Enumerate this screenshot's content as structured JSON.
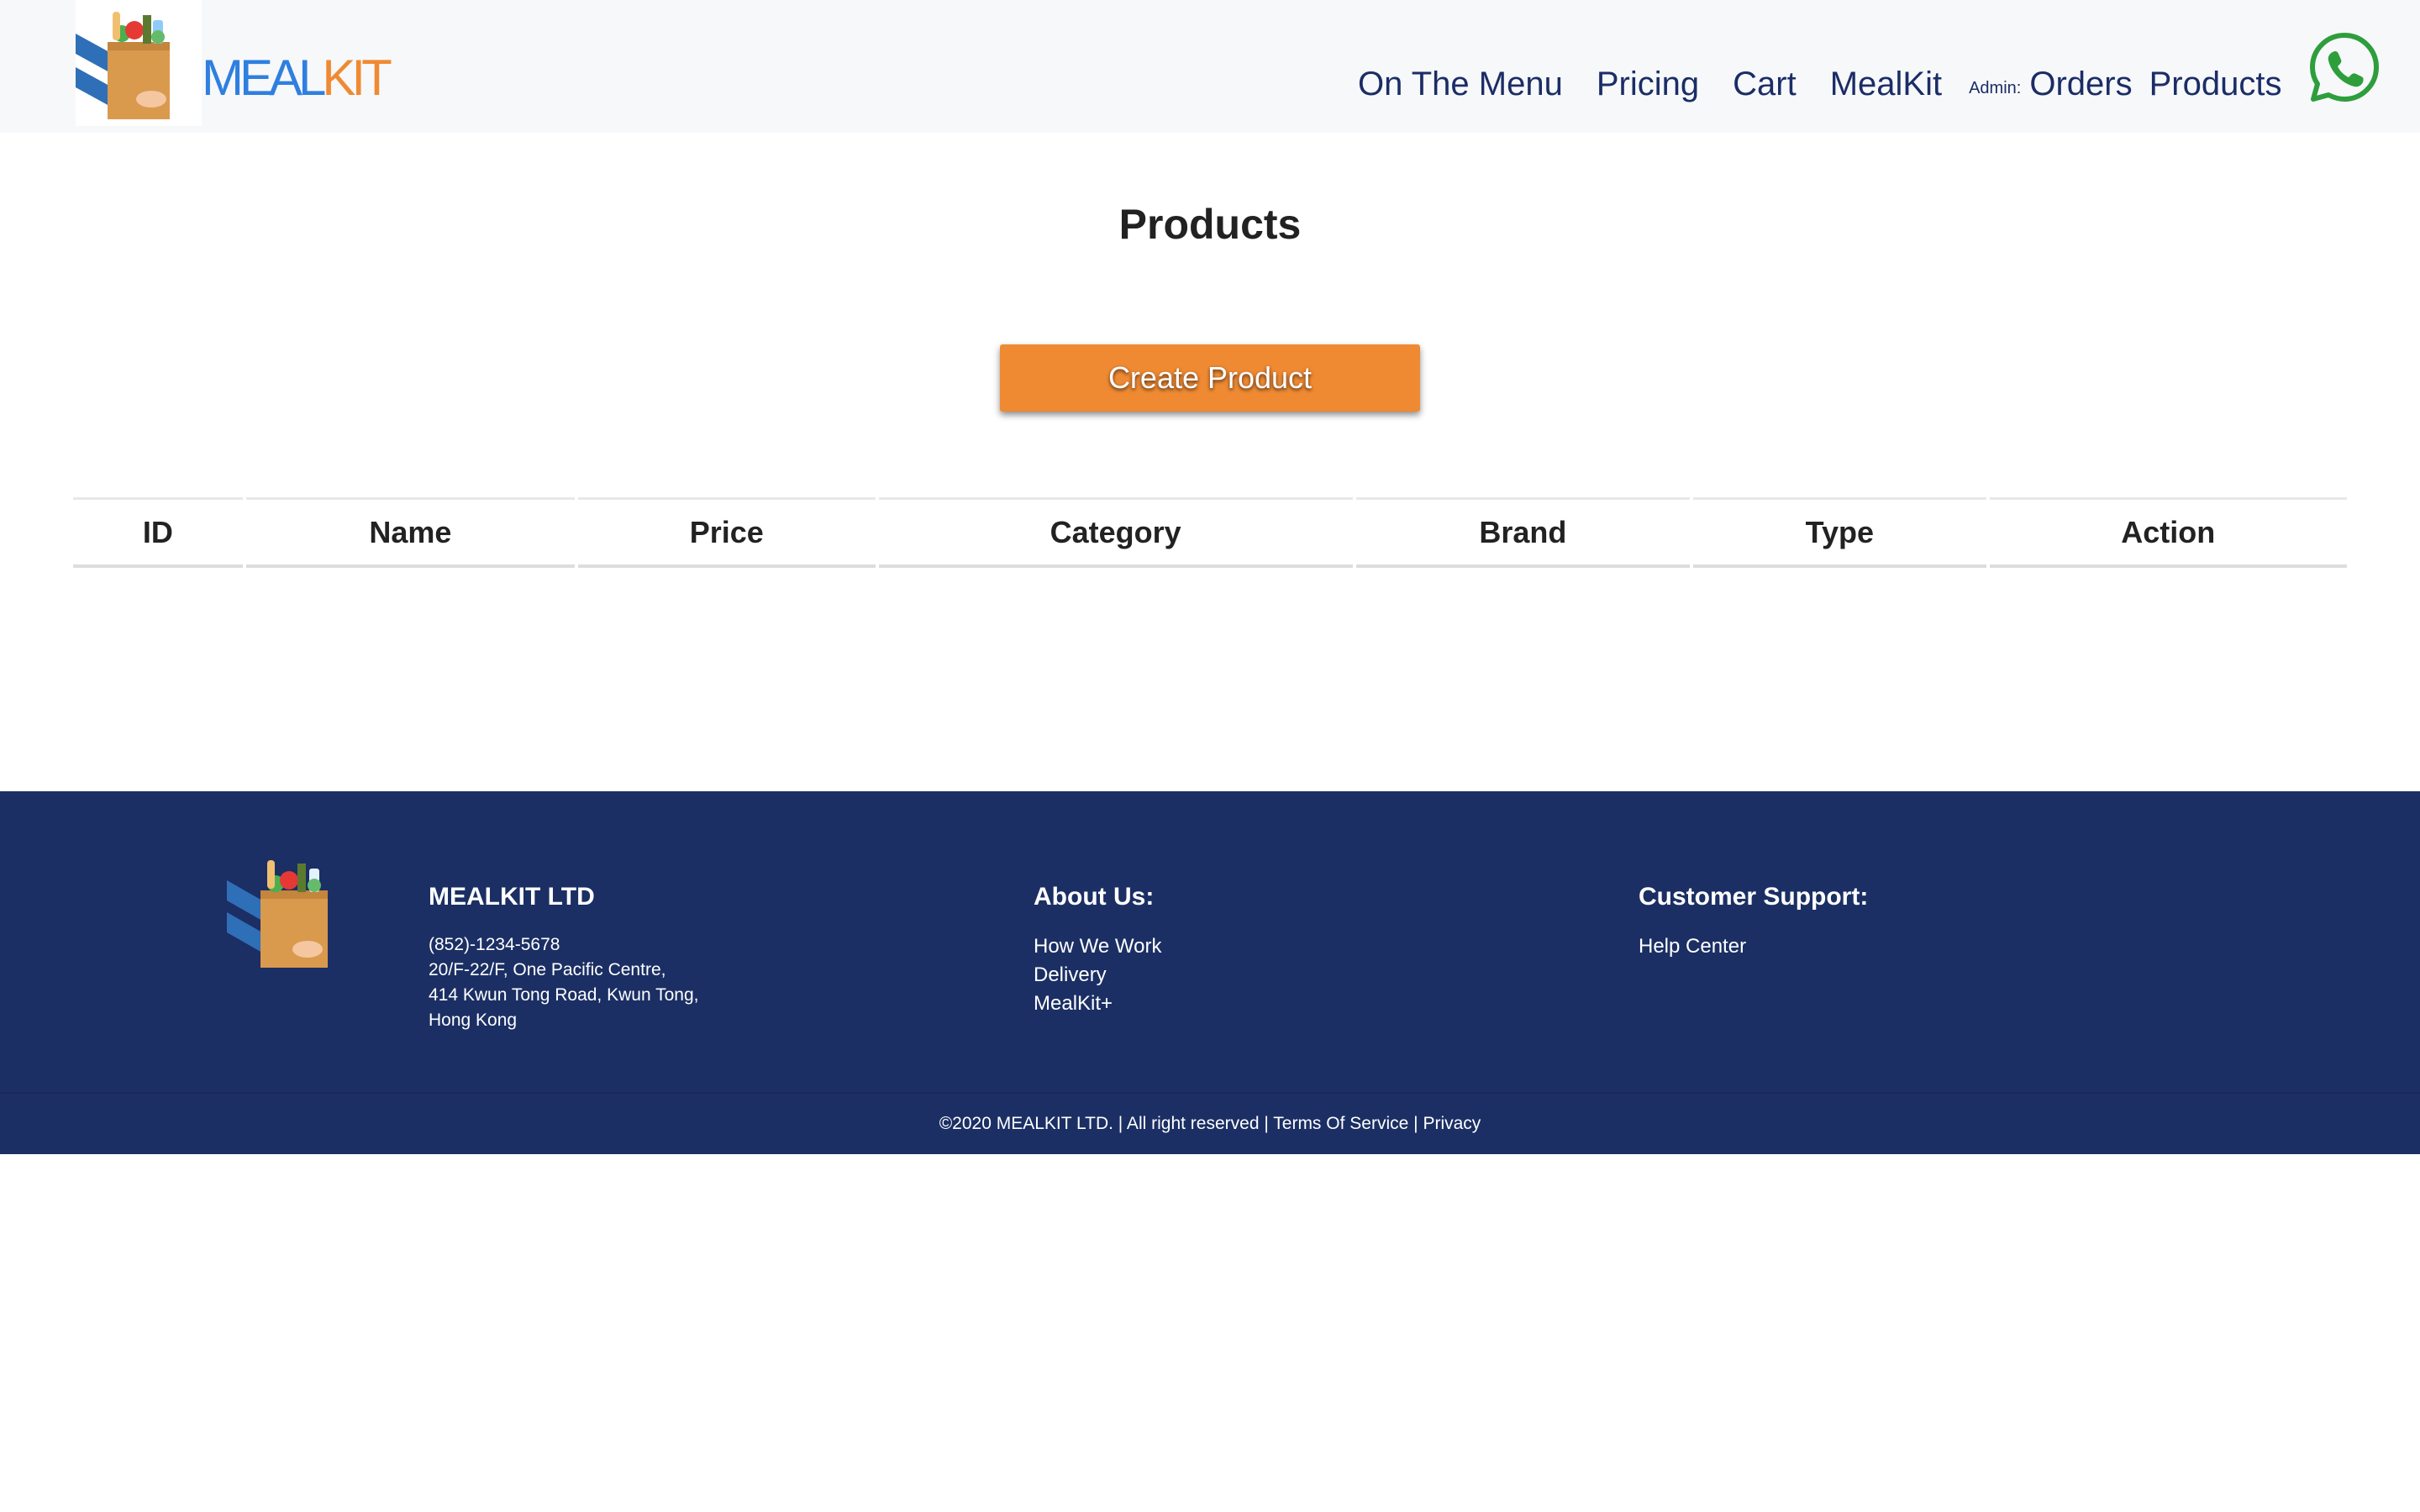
{
  "header": {
    "brand_part1": "MEAL",
    "brand_part2": "KIT",
    "nav": {
      "menu": "On The Menu",
      "pricing": "Pricing",
      "cart": "Cart",
      "mealkit": "MealKit",
      "admin_label": "Admin:",
      "orders": "Orders",
      "products": "Products"
    },
    "whatsapp_icon": "whatsapp-icon"
  },
  "main": {
    "title": "Products",
    "create_button": "Create Product",
    "table": {
      "columns": [
        "ID",
        "Name",
        "Price",
        "Category",
        "Brand",
        "Type",
        "Action"
      ],
      "rows": []
    }
  },
  "footer": {
    "company": {
      "name": "MEALKIT LTD",
      "phone": "(852)-1234-5678",
      "address_line1": "20/F-22/F, One Pacific Centre,",
      "address_line2": "414 Kwun Tong Road, Kwun Tong,",
      "address_line3": "Hong Kong"
    },
    "about": {
      "heading": "About Us:",
      "links": [
        "How We Work",
        "Delivery",
        "MealKit+"
      ]
    },
    "support": {
      "heading": "Customer Support:",
      "links": [
        "Help Center"
      ]
    },
    "copyright": {
      "text": "©2020 MEALKIT LTD. | All right reserved |",
      "terms": "Terms Of Service",
      "separator": "|",
      "privacy": "Privacy"
    }
  },
  "colors": {
    "navy": "#1b2f64",
    "orange": "#ef8a33",
    "blue": "#2f7fe0",
    "whatsapp": "#2e9e3c"
  }
}
